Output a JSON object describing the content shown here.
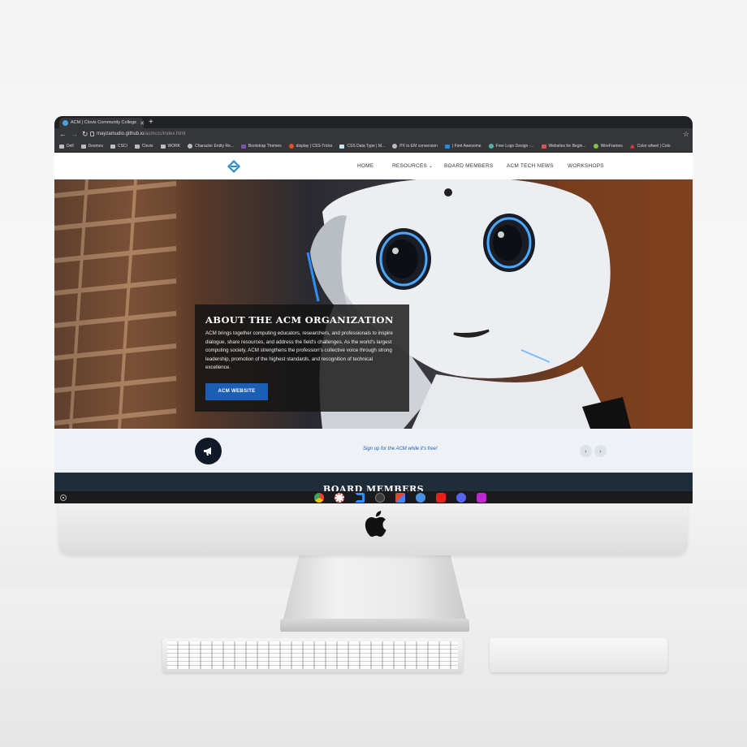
{
  "browser": {
    "tab_title": "ACM | Clovis Community College",
    "url_host": "mayzamudio.github.io",
    "url_path": "/acmccc/index.html",
    "bookmarks": [
      "Dell",
      "Desmos",
      "CSCI",
      "Clovis",
      "WORK",
      "Character Entity Re...",
      "Bootstrap Themes",
      "display | CSS-Tricks",
      "CSS Data Type | M...",
      "PX to EM conversion",
      "| Font Awesome",
      "Free Logo Design -...",
      "Websites for Begin...",
      "WireFrames",
      "Color wheel | Colo"
    ]
  },
  "site": {
    "nav": [
      "HOME",
      "RESOURCES",
      "BOARD MEMBERS",
      "ACM TECH NEWS",
      "WORKSHOPS"
    ],
    "about": {
      "title": "ABOUT THE ACM ORGANIZATION",
      "text": "ACM brings together computing educators, researchers, and professionals to inspire dialogue, share resources, and address the field's challenges. As the world's largest computing society, ACM strengthens the profession's collective voice through strong leadership, promotion of the highest standards, and recognition of technical excellence.",
      "button": "ACM WEBSITE"
    },
    "news": {
      "text": "Sign up for the ACM while it's free!",
      "prev": "‹",
      "next": "›"
    },
    "board_title": "BOARD MEMBERS"
  },
  "colors": {
    "accent": "#1a5fb4",
    "dark_band": "#1f2d3a"
  },
  "icons": [
    "chrome-icon",
    "photos-icon",
    "vscode-icon",
    "terminal-icon",
    "gmail-icon",
    "files-icon",
    "youtube-icon",
    "discord-icon",
    "app-icon"
  ]
}
